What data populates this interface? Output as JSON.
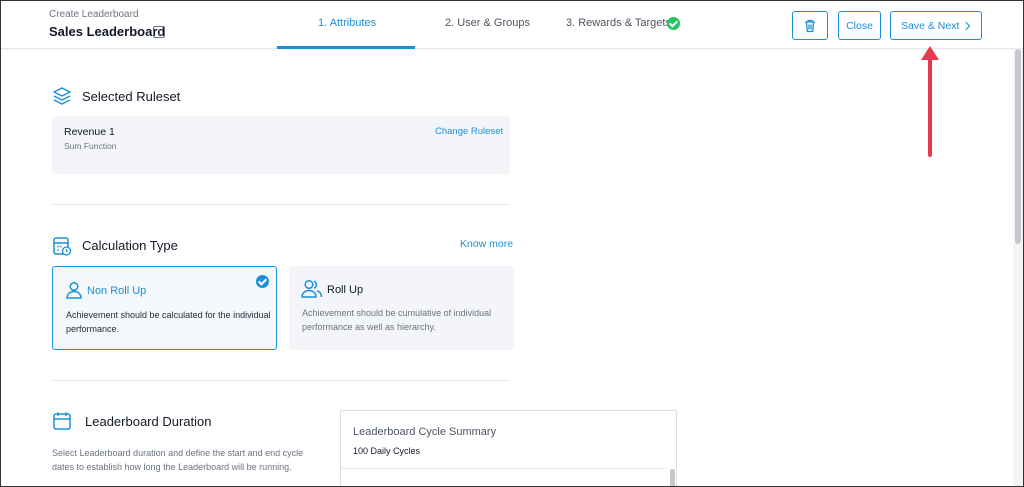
{
  "header": {
    "breadcrumb": "Create Leaderboard",
    "leaderboard_name": "Sales Leaderboard",
    "tabs": [
      {
        "label": "1. Attributes",
        "active": true
      },
      {
        "label": "2. User & Groups",
        "active": false
      },
      {
        "label": "3. Rewards & Targets",
        "active": false,
        "completed": true
      }
    ],
    "buttons": {
      "delete_icon": "trash-icon",
      "close_label": "Close",
      "save_label": "Save & Next"
    }
  },
  "ruleset": {
    "section_title": "Selected Ruleset",
    "icon": "layers-icon",
    "name": "Revenue 1",
    "function": "Sum Function",
    "change_link": "Change Ruleset"
  },
  "calculation": {
    "section_title": "Calculation Type",
    "icon": "calculator-icon",
    "know_more": "Know more",
    "options": [
      {
        "title": "Non Roll Up",
        "description": "Achievement should be calculated for the individual performance.",
        "selected": true,
        "icon": "user-icon"
      },
      {
        "title": "Roll Up",
        "description": "Achievement should be cumulative of individual performance as well as hierarchy.",
        "selected": false,
        "icon": "users-icon"
      }
    ]
  },
  "duration": {
    "section_title": "Leaderboard Duration",
    "icon": "calendar-icon",
    "description": "Select Leaderboard duration and define the start and end cycle dates to establish how long the Leaderboard will be running.",
    "summary_title": "Leaderboard Cycle Summary",
    "summary_count": "100 Daily Cycles"
  },
  "colors": {
    "accent": "#1c8fd6",
    "success": "#22c55e",
    "annotation_arrow": "#e8384f"
  }
}
